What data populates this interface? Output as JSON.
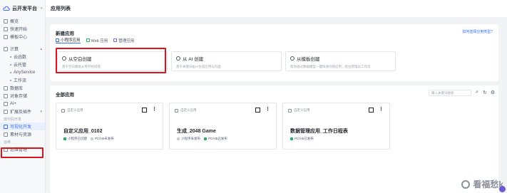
{
  "brand": {
    "name": "云开发平台",
    "collapse": "«"
  },
  "sidebar": {
    "top_items": [
      {
        "label": "概览"
      },
      {
        "label": "快速开始"
      },
      {
        "label": "模板中心"
      }
    ],
    "compute": {
      "label": "计算",
      "subs": [
        "云函数",
        "云托管",
        "AnyService",
        "工作流"
      ]
    },
    "items2": [
      {
        "label": "数据库"
      },
      {
        "label": "对象存储"
      },
      {
        "label": "AI+"
      },
      {
        "label": "扩展及插件"
      }
    ],
    "group_label": "低代码开发",
    "active_item": "可视化开发",
    "items3": [
      {
        "label": "素材与资源"
      }
    ],
    "group_label2": "运维",
    "items4": [
      {
        "label": "运维管理"
      }
    ]
  },
  "topbar": {
    "title": "应用列表"
  },
  "new_app": {
    "title": "新建应用",
    "help": "如何选择应用类型?",
    "tabs": [
      {
        "label": "小程序应用"
      },
      {
        "label": "Web 应用"
      },
      {
        "label": "管理应用"
      }
    ],
    "cards": [
      {
        "title": "从空白创建",
        "desc": "基于空白模板从零开始搭建"
      },
      {
        "title": "从 AI 创建",
        "desc": "基于关键词由AI生成应用与页面"
      },
      {
        "title": "从模板创建",
        "desc": "帮你通过数据模型一键快速创建应用，后台管理员工作流"
      }
    ]
  },
  "all_apps": {
    "title": "全部应用",
    "search_placeholder": "输入关键词搜索",
    "apps": [
      {
        "type": "自定义应用",
        "name": "自定义应用_0102",
        "badges": [
          {
            "label": "小程序已创建",
            "color": "#27ae60"
          },
          {
            "label": "PC/H5未发布",
            "color": "#c9cdd4"
          }
        ]
      },
      {
        "type": "自定义应用",
        "name": "生成_2048 Game",
        "badges": [
          {
            "label": "小程序未发布",
            "color": "#c9cdd4"
          },
          {
            "label": "PC/H5已发布",
            "color": "#27ae60"
          }
        ]
      },
      {
        "type": "自定义应用",
        "name": "数据管理应用_工作日程表",
        "badges": [
          {
            "label": "PC/H5已发布",
            "color": "#27ae60"
          }
        ]
      }
    ]
  },
  "watermark": "看福愁k"
}
